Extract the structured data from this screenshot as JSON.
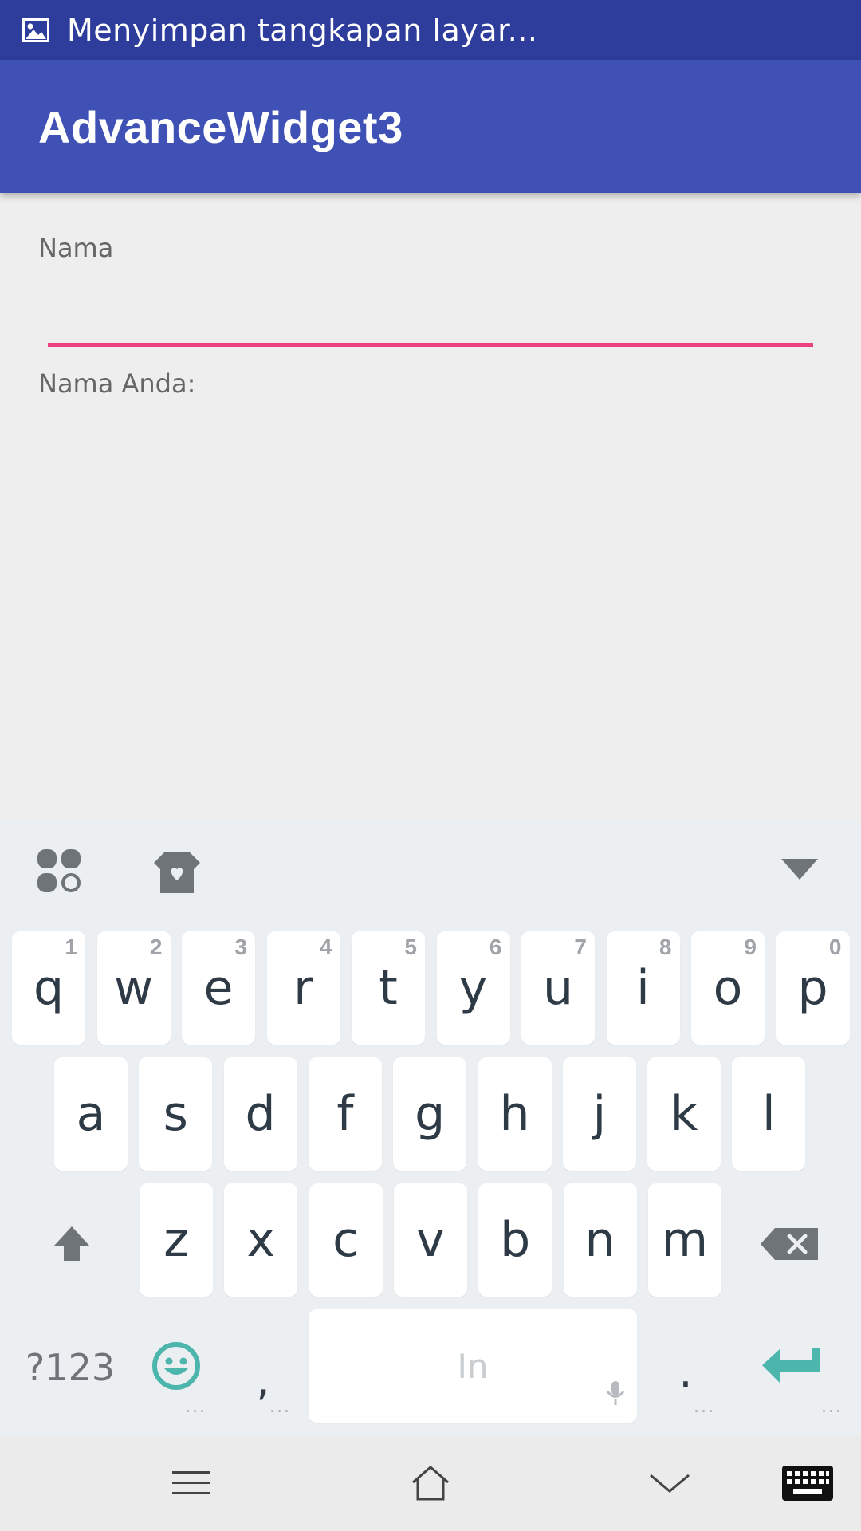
{
  "status_bar": {
    "notification_text": "Menyimpan tangkapan layar...",
    "icon": "image-icon"
  },
  "app_bar": {
    "title": "AdvanceWidget3"
  },
  "form": {
    "name_label": "Nama",
    "name_value": "",
    "result_label": "Nama Anda:"
  },
  "keyboard": {
    "toolbar": {
      "left_icons": [
        "apps-grid-icon",
        "theme-shirt-icon"
      ],
      "right_icon": "hide-keyboard-icon"
    },
    "row1": [
      {
        "key": "q",
        "hint": "1"
      },
      {
        "key": "w",
        "hint": "2"
      },
      {
        "key": "e",
        "hint": "3"
      },
      {
        "key": "r",
        "hint": "4"
      },
      {
        "key": "t",
        "hint": "5"
      },
      {
        "key": "y",
        "hint": "6"
      },
      {
        "key": "u",
        "hint": "7"
      },
      {
        "key": "i",
        "hint": "8"
      },
      {
        "key": "o",
        "hint": "9"
      },
      {
        "key": "p",
        "hint": "0"
      }
    ],
    "row2": [
      "a",
      "s",
      "d",
      "f",
      "g",
      "h",
      "j",
      "k",
      "l"
    ],
    "row3": [
      "z",
      "x",
      "c",
      "v",
      "b",
      "n",
      "m"
    ],
    "bottom": {
      "symbols_label": "?123",
      "comma": ",",
      "space_label": "In",
      "period": ".",
      "dots": "..."
    },
    "accent_color": "#4db6ac"
  },
  "nav_bar": {
    "icons": [
      "menu-icon",
      "home-icon",
      "back-down-icon",
      "keyboard-switch-icon"
    ]
  },
  "colors": {
    "status_bar": "#2e3d9c",
    "app_bar": "#3f51b5",
    "input_underline": "#ee3f7e",
    "background": "#eeeeee"
  }
}
